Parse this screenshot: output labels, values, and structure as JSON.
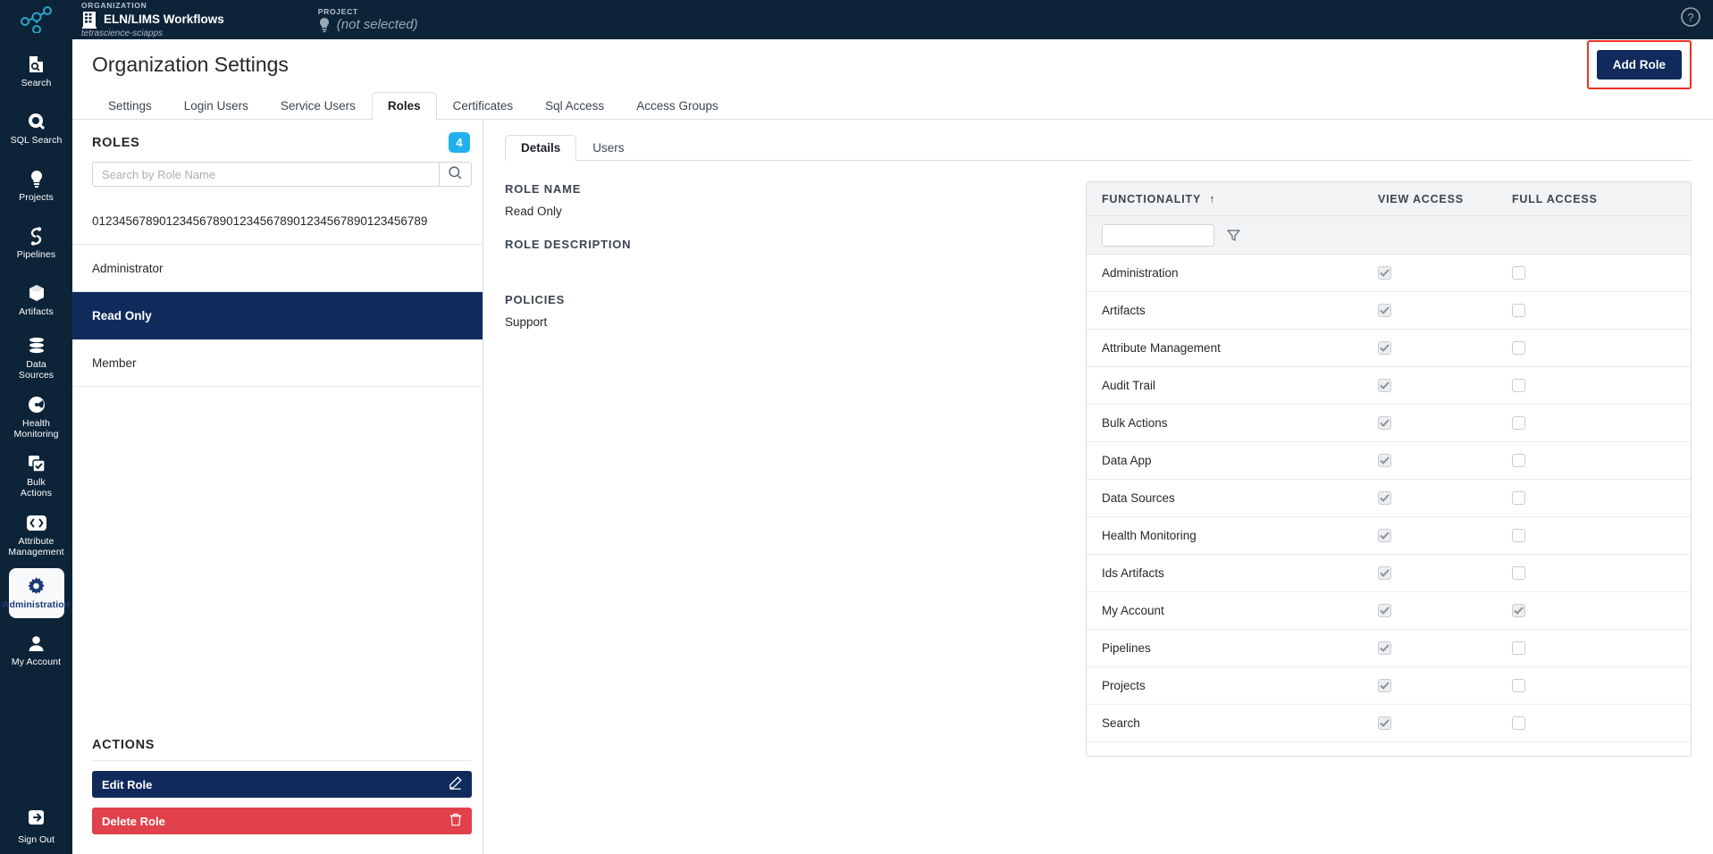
{
  "topbar": {
    "org_kicker": "ORGANIZATION",
    "org_name": "ELN/LIMS Workflows",
    "org_slug": "tetrascience-sciapps",
    "project_kicker": "PROJECT",
    "project_value": "(not selected)",
    "help_icon": "help-circle-icon"
  },
  "sidebar": {
    "items": [
      {
        "label": "Search",
        "icon": "document-search-icon",
        "active": false
      },
      {
        "label": "SQL Search",
        "icon": "magnifier-icon",
        "active": false
      },
      {
        "label": "Projects",
        "icon": "lightbulb-icon",
        "active": false
      },
      {
        "label": "Pipelines",
        "icon": "pipeline-link-icon",
        "active": false
      },
      {
        "label": "Artifacts",
        "icon": "cube-icon",
        "active": false
      },
      {
        "label": "Data Sources",
        "icon": "database-stack-icon",
        "active": false
      },
      {
        "label": "Health Monitoring",
        "icon": "gauge-icon",
        "active": false
      },
      {
        "label": "Bulk Actions",
        "icon": "checkbox-stack-icon",
        "active": false
      },
      {
        "label": "Attribute Management",
        "icon": "code-brackets-icon",
        "active": false
      },
      {
        "label": "Administration",
        "icon": "gear-icon",
        "active": true
      },
      {
        "label": "My Account",
        "icon": "user-icon",
        "active": false
      }
    ],
    "signout": {
      "label": "Sign Out",
      "icon": "sign-out-icon"
    }
  },
  "page": {
    "title": "Organization Settings",
    "add_role_label": "Add Role",
    "highlight_color": "#ee3124",
    "primary_color": "#102a5c"
  },
  "tabs": [
    {
      "label": "Settings",
      "active": false
    },
    {
      "label": "Login Users",
      "active": false
    },
    {
      "label": "Service Users",
      "active": false
    },
    {
      "label": "Roles",
      "active": true
    },
    {
      "label": "Certificates",
      "active": false
    },
    {
      "label": "Sql Access",
      "active": false
    },
    {
      "label": "Access Groups",
      "active": false
    }
  ],
  "roles_panel": {
    "title": "ROLES",
    "count": "4",
    "search_placeholder": "Search by Role Name",
    "search_value": "",
    "search_icon": "search-icon",
    "items": [
      {
        "label": "01234567890123456789012345678901234567890123456789",
        "selected": false
      },
      {
        "label": "Administrator",
        "selected": false
      },
      {
        "label": "Read Only",
        "selected": true
      },
      {
        "label": "Member",
        "selected": false
      }
    ],
    "actions_title": "ACTIONS",
    "edit_label": "Edit Role",
    "edit_icon": "pencil-icon",
    "delete_label": "Delete Role",
    "delete_icon": "trash-icon"
  },
  "details": {
    "subtabs": [
      {
        "label": "Details",
        "active": true
      },
      {
        "label": "Users",
        "active": false
      }
    ],
    "role_name_label": "ROLE NAME",
    "role_name_value": "Read Only",
    "role_description_label": "ROLE DESCRIPTION",
    "role_description_value": "",
    "policies_label": "POLICIES",
    "policies_value": "Support"
  },
  "functionality_table": {
    "columns": {
      "functionality": "FUNCTIONALITY",
      "sort_indicator": "↑",
      "view_access": "VIEW ACCESS",
      "full_access": "FULL ACCESS"
    },
    "filter_value": "",
    "filter_icon": "funnel-icon",
    "rows": [
      {
        "name": "Administration",
        "view": true,
        "full": false
      },
      {
        "name": "Artifacts",
        "view": true,
        "full": false
      },
      {
        "name": "Attribute Management",
        "view": true,
        "full": false
      },
      {
        "name": "Audit Trail",
        "view": true,
        "full": false
      },
      {
        "name": "Bulk Actions",
        "view": true,
        "full": false
      },
      {
        "name": "Data App",
        "view": true,
        "full": false
      },
      {
        "name": "Data Sources",
        "view": true,
        "full": false
      },
      {
        "name": "Health Monitoring",
        "view": true,
        "full": false
      },
      {
        "name": "Ids Artifacts",
        "view": true,
        "full": false
      },
      {
        "name": "My Account",
        "view": true,
        "full": true
      },
      {
        "name": "Pipelines",
        "view": true,
        "full": false
      },
      {
        "name": "Projects",
        "view": true,
        "full": false
      },
      {
        "name": "Search",
        "view": true,
        "full": false
      }
    ]
  }
}
